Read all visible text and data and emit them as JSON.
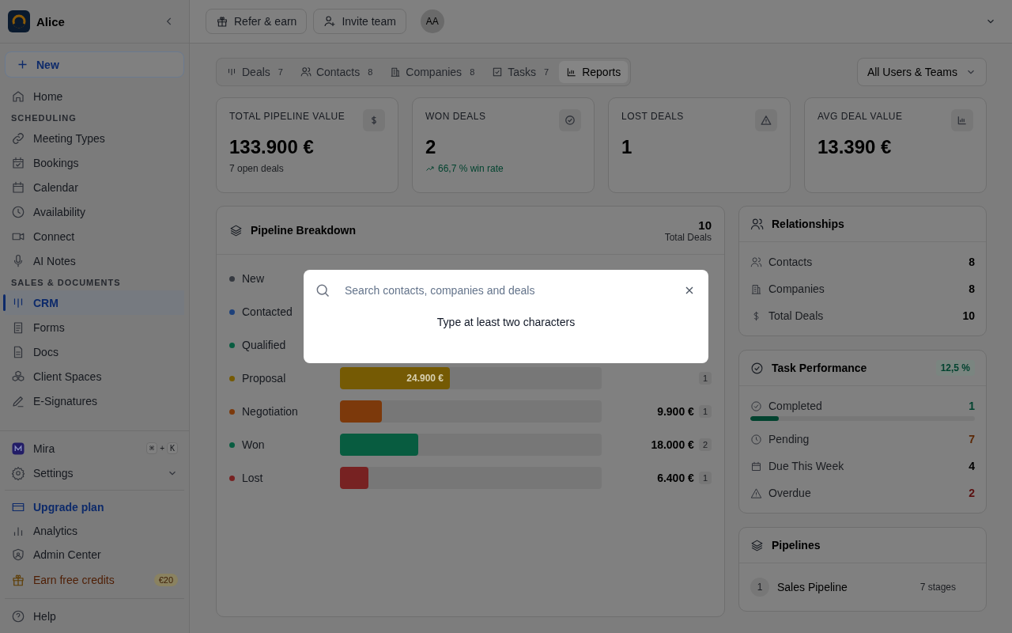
{
  "sidebar": {
    "workspace": "Alice",
    "new_button": "New",
    "nav": [
      {
        "kind": "link",
        "label": "Home",
        "selected": false
      },
      {
        "kind": "heading",
        "label": "SCHEDULING"
      },
      {
        "kind": "link",
        "label": "Meeting Types",
        "selected": false
      },
      {
        "kind": "link",
        "label": "Bookings",
        "selected": false
      },
      {
        "kind": "link",
        "label": "Calendar",
        "selected": false
      },
      {
        "kind": "link",
        "label": "Availability",
        "selected": false
      },
      {
        "kind": "link",
        "label": "Connect",
        "selected": false
      },
      {
        "kind": "link",
        "label": "AI Notes",
        "selected": false
      },
      {
        "kind": "heading",
        "label": "SALES & DOCUMENTS"
      },
      {
        "kind": "link",
        "label": "CRM",
        "selected": true
      },
      {
        "kind": "link",
        "label": "Forms",
        "selected": false
      },
      {
        "kind": "link",
        "label": "Docs",
        "selected": false
      },
      {
        "kind": "link",
        "label": "Client Spaces",
        "selected": false
      },
      {
        "kind": "link",
        "label": "E-Signatures",
        "selected": false
      }
    ],
    "assistant": {
      "label": "Mira",
      "keys": [
        "⌘",
        "+",
        "K"
      ]
    },
    "settings": {
      "label": "Settings"
    },
    "footer": [
      {
        "kind": "upgrade",
        "label": "Upgrade plan"
      },
      {
        "kind": "plain",
        "label": "Analytics"
      },
      {
        "kind": "plain",
        "label": "Admin Center"
      },
      {
        "kind": "credits",
        "label": "Earn free credits",
        "badge": "€20"
      }
    ],
    "help": "Help"
  },
  "header": {
    "buttons": [
      "Refer & earn",
      "Invite team"
    ],
    "avatar": "AA"
  },
  "tabs": [
    {
      "label": "Deals",
      "count": "7",
      "selected": false
    },
    {
      "label": "Contacts",
      "count": "8",
      "selected": false
    },
    {
      "label": "Companies",
      "count": "8",
      "selected": false
    },
    {
      "label": "Tasks",
      "count": "7",
      "selected": false
    },
    {
      "label": "Reports",
      "selected": true
    }
  ],
  "filter": "All Users & Teams",
  "stats": [
    {
      "label": "TOTAL PIPELINE VALUE",
      "value": "133.900 €",
      "note": "7 open deals",
      "trend_up": false
    },
    {
      "label": "WON DEALS",
      "value": "2",
      "note": "66,7 % win rate",
      "trend_up": true
    },
    {
      "label": "LOST DEALS",
      "value": "1"
    },
    {
      "label": "AVG DEAL VALUE",
      "value": "13.390 €"
    }
  ],
  "pipeline": {
    "title": "Pipeline Breakdown",
    "total": "10",
    "total_label": "Total Deals",
    "stages": [
      {
        "name": "New",
        "color": "#353940"
      },
      {
        "name": "Contacted",
        "color": "#1d417b"
      },
      {
        "name": "Qualified",
        "color": "#085c40"
      },
      {
        "name": "Proposal",
        "color": "#755a04",
        "level": 0.42,
        "bar_label": "24.900 €",
        "count": "1"
      },
      {
        "name": "Negotiation",
        "color": "#7c390b",
        "level": 0.16,
        "value": "9.900 €",
        "count": "1"
      },
      {
        "name": "Won",
        "color": "#085c40",
        "level": 0.3,
        "value": "18.000 €",
        "count": "2"
      },
      {
        "name": "Lost",
        "color": "#772222",
        "level": 0.11,
        "value": "6.400 €",
        "count": "1"
      }
    ]
  },
  "relationships": {
    "title": "Relationships",
    "rows": [
      {
        "label": "Contacts",
        "value": "8"
      },
      {
        "label": "Companies",
        "value": "8"
      },
      {
        "label": "Total Deals",
        "value": "10"
      }
    ]
  },
  "tasks": {
    "title": "Task Performance",
    "badge": "12,5 %",
    "level": 0.125,
    "rows": [
      {
        "label": "Completed",
        "value": "1",
        "color": "#02432f"
      },
      {
        "label": "Pending",
        "value": "7",
        "color": "#5a2705"
      },
      {
        "label": "Due This Week",
        "value": "4",
        "color": "#000000"
      },
      {
        "label": "Overdue",
        "value": "2",
        "color": "#5a1010"
      }
    ]
  },
  "pipelines": {
    "title": "Pipelines",
    "items": [
      {
        "index": "1",
        "name": "Sales Pipeline",
        "stages": "7 stages"
      }
    ]
  },
  "search": {
    "placeholder": "Search contacts, companies and deals",
    "hint": "Type at least two characters"
  }
}
